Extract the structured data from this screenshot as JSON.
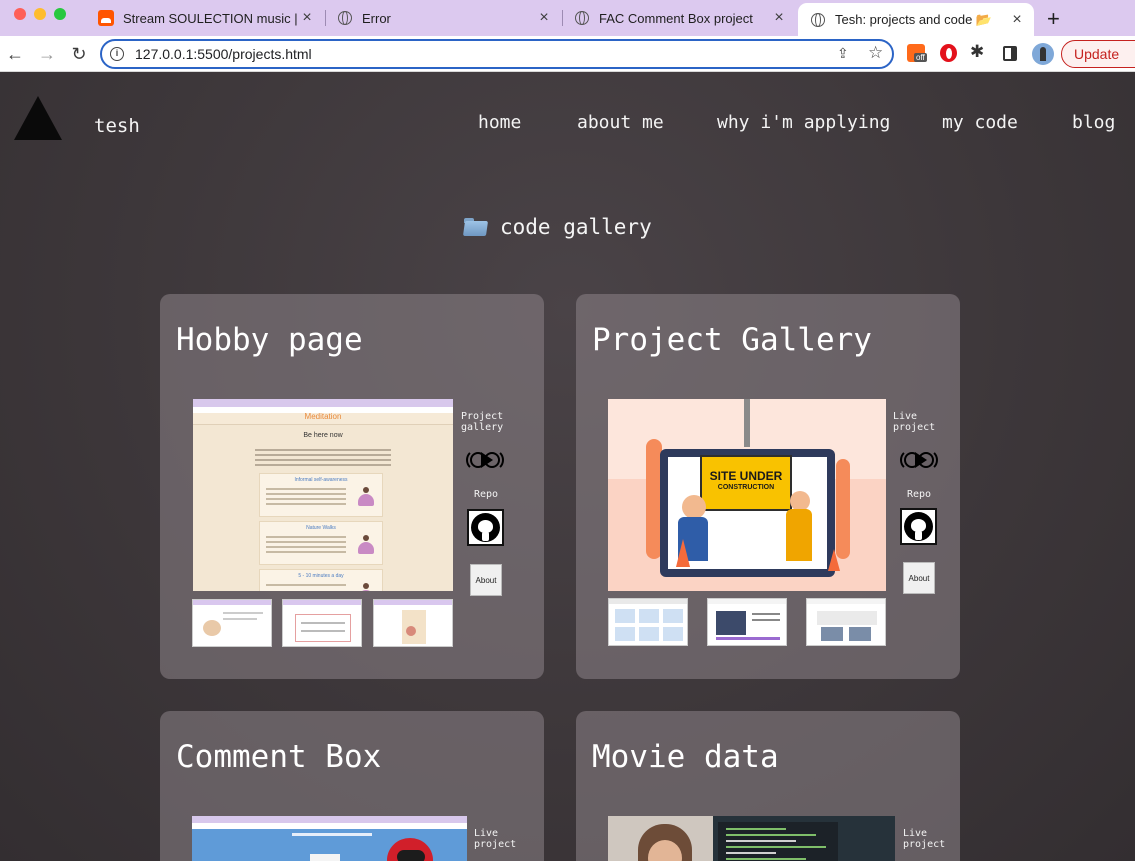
{
  "browser": {
    "tabs": [
      {
        "title": "Stream SOULECTION music | L",
        "favicon": "soundcloud-icon",
        "active": false
      },
      {
        "title": "Error",
        "favicon": "globe-icon",
        "active": false
      },
      {
        "title": "FAC Comment Box project",
        "favicon": "globe-icon",
        "active": false
      },
      {
        "title": "Tesh: projects and code 📂",
        "favicon": "globe-icon",
        "active": true
      }
    ],
    "url": "127.0.0.1:5500/projects.html",
    "update_label": "Update",
    "extension_badge": "off"
  },
  "site": {
    "brand": "tesh",
    "nav": [
      "home",
      "about me",
      "why i'm applying",
      "my code",
      "blog"
    ],
    "gallery_title": "code gallery"
  },
  "projects": [
    {
      "title": "Hobby page",
      "link_label": "Project gallery",
      "repo_label": "Repo",
      "about_label": "About",
      "preview": {
        "heading": "Meditation",
        "subheading": "Be here now",
        "sections": [
          "Informal self-awareness",
          "Nature Walks",
          "5 - 10 minutes a day"
        ]
      }
    },
    {
      "title": "Project Gallery",
      "link_label": "Live project",
      "repo_label": "Repo",
      "about_label": "About",
      "preview": {
        "sign_line1": "SITE UNDER",
        "sign_line2": "CONSTRUCTION"
      }
    },
    {
      "title": "Comment Box",
      "link_label": "Live project"
    },
    {
      "title": "Movie data",
      "link_label": "Live project"
    }
  ],
  "colors": {
    "accent_link": "#2b64c6",
    "update": "#c5221f",
    "card_bg": "#6e686c",
    "page_bg": "#3d373a"
  }
}
